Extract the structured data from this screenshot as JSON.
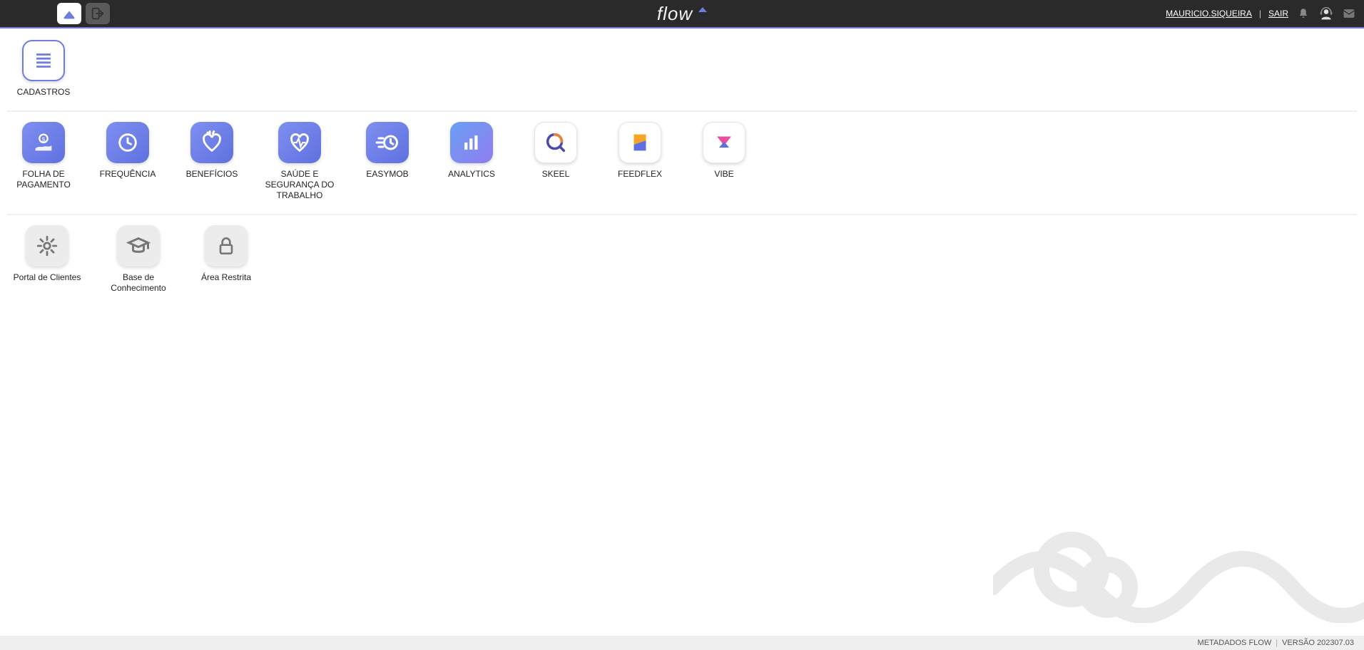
{
  "header": {
    "brand": "flow",
    "user": "MAURICIO.SIQUEIRA",
    "logout_label": "SAIR"
  },
  "sections": {
    "row1": {
      "cadastros": "CADASTROS"
    },
    "row2": {
      "folha": "FOLHA DE PAGAMENTO",
      "frequencia": "FREQUÊNCIA",
      "beneficios": "BENEFÍCIOS",
      "saude": "SAÚDE E SEGURANÇA DO TRABALHO",
      "easymob": "EASYMOB",
      "analytics": "ANALYTICS",
      "skeel": "SKEEL",
      "feedflex": "FEEDFLEX",
      "vibe": "VIBE"
    },
    "row3": {
      "portal": "Portal de Clientes",
      "base": "Base de Conhecimento",
      "area": "Área Restrita"
    }
  },
  "footer": {
    "brand": "METADADOS FLOW",
    "version": "VERSÃO 202307.03"
  }
}
